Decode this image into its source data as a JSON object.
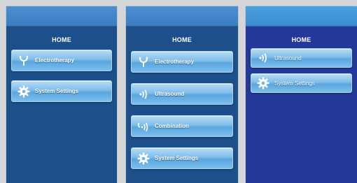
{
  "screens": [
    {
      "title": "HOME",
      "buttons": [
        {
          "label": "Electrotherapy",
          "icon": "electrotherapy-icon"
        },
        {
          "label": "System Settings",
          "icon": "gear-icon"
        }
      ]
    },
    {
      "title": "HOME",
      "buttons": [
        {
          "label": "Electrotherapy",
          "icon": "electrotherapy-icon"
        },
        {
          "label": "Ultrasound",
          "icon": "ultrasound-icon"
        },
        {
          "label": "Combination",
          "icon": "combination-icon"
        },
        {
          "label": "System Settings",
          "icon": "gear-icon"
        }
      ]
    },
    {
      "title": "HOME",
      "buttons": [
        {
          "label": "Ultrasound",
          "icon": "ultrasound-icon"
        },
        {
          "label": "System Settings",
          "icon": "gear-icon"
        }
      ]
    }
  ],
  "colors": {
    "page_background": "#d5d6d8",
    "screen_background": "#1d4f8a",
    "screen3_background": "#24389a",
    "button_gradient_top": "#b7dcf6",
    "button_gradient_bottom": "#5aa6e0"
  }
}
